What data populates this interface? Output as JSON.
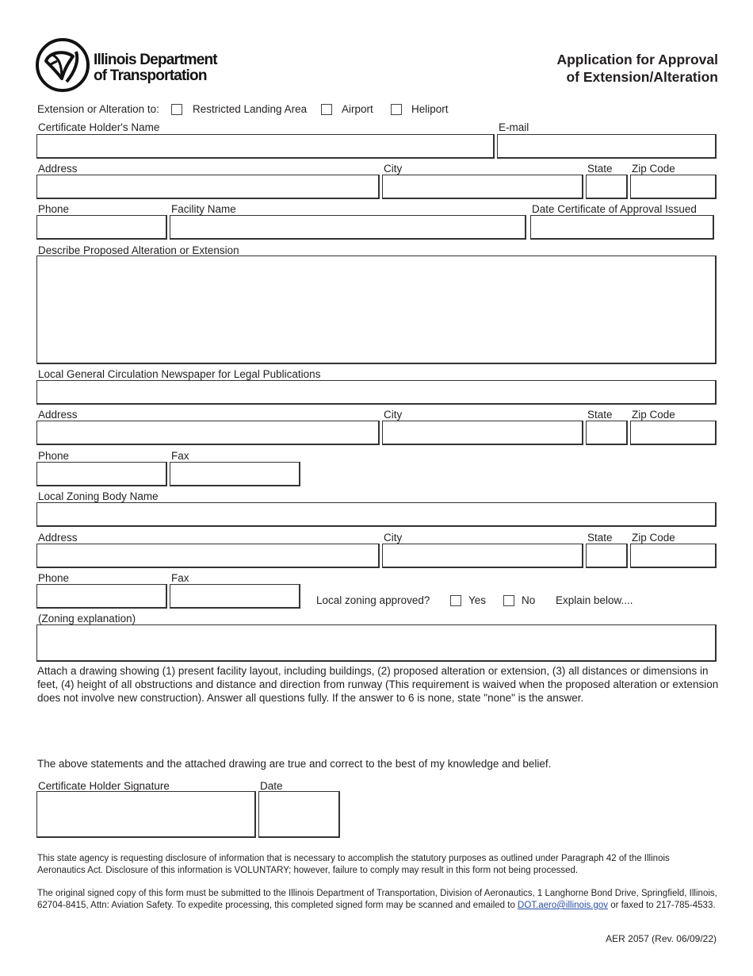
{
  "header": {
    "agency_line1": "Illinois Department",
    "agency_line2": "of Transportation",
    "title_line1": "Application for Approval",
    "title_line2": "of Extension/Alteration",
    "logo_icon": "idot-triskelion-logo"
  },
  "extension_type": {
    "label": "Extension or Alteration to:",
    "options": [
      {
        "label": "Restricted Landing Area",
        "checked": false
      },
      {
        "label": "Airport",
        "checked": false
      },
      {
        "label": "Heliport",
        "checked": false
      }
    ]
  },
  "certificate_holder": {
    "name_label": "Certificate Holder's Name",
    "name_value": "",
    "email_label": "E-mail",
    "email_value": "",
    "address_label": "Address",
    "address_value": "",
    "city_label": "City",
    "city_value": "",
    "state_label": "State",
    "state_value": "",
    "zip_label": "Zip Code",
    "zip_value": "",
    "phone_label": "Phone",
    "phone_value": "",
    "facility_label": "Facility Name",
    "facility_value": "",
    "date_issued_label": "Date Certificate of Approval Issued",
    "date_issued_value": ""
  },
  "description": {
    "label": "Describe Proposed Alteration or Extension",
    "value": ""
  },
  "newspaper": {
    "name_label": "Local General Circulation Newspaper for Legal Publications",
    "name_value": "",
    "address_label": "Address",
    "address_value": "",
    "city_label": "City",
    "city_value": "",
    "state_label": "State",
    "state_value": "",
    "zip_label": "Zip Code",
    "zip_value": "",
    "phone_label": "Phone",
    "phone_value": "",
    "fax_label": "Fax",
    "fax_value": ""
  },
  "zoning": {
    "name_label": "Local Zoning Body Name",
    "name_value": "",
    "address_label": "Address",
    "address_value": "",
    "city_label": "City",
    "city_value": "",
    "state_label": "State",
    "state_value": "",
    "zip_label": "Zip Code",
    "zip_value": "",
    "phone_label": "Phone",
    "phone_value": "",
    "fax_label": "Fax",
    "fax_value": "",
    "approved_question": "Local zoning approved?",
    "yes_label": "Yes",
    "yes_checked": false,
    "no_label": "No",
    "no_checked": false,
    "explain_hint": "Explain below....",
    "explanation_label": "(Zoning explanation)",
    "explanation_value": ""
  },
  "instructions": "Attach a drawing showing (1) present facility layout, including buildings, (2) proposed alteration or extension, (3) all distances or dimensions in feet, (4) height of all obstructions and distance and direction from runway (This requirement is waived when the proposed alteration or extension does not involve new construction).  Answer all questions fully.  If the answer to 6 is none, state \"none\" is the answer.",
  "attestation": "The above statements and the attached drawing are true and correct to the best of my knowledge and belief.",
  "signature": {
    "signature_label": "Certificate Holder Signature",
    "signature_value": "",
    "date_label": "Date",
    "date_value": ""
  },
  "disclosure": "This state agency is requesting disclosure of information that is necessary to accomplish the statutory purposes as outlined under Paragraph 42 of the Illinois Aeronautics Act.  Disclosure of this information is VOLUNTARY; however, failure to comply may result in this form not being processed.",
  "submission": {
    "text_before_link": "The original signed copy of this form must be submitted to the Illinois Department of Transportation, Division of Aeronautics, 1 Langhorne Bond Drive, Springfield, Illinois, 62704-8415, Attn: Aviation Safety.  To expedite processing, this completed signed form may be scanned and emailed to ",
    "email_link": "DOT.aero@illinois.gov",
    "text_after_link": " or faxed to 217-785-4533."
  },
  "form_code": "AER 2057 (Rev. 06/09/22)",
  "colors": {
    "text": "#231f20",
    "link": "#2a4ea6",
    "border": "#333333"
  }
}
